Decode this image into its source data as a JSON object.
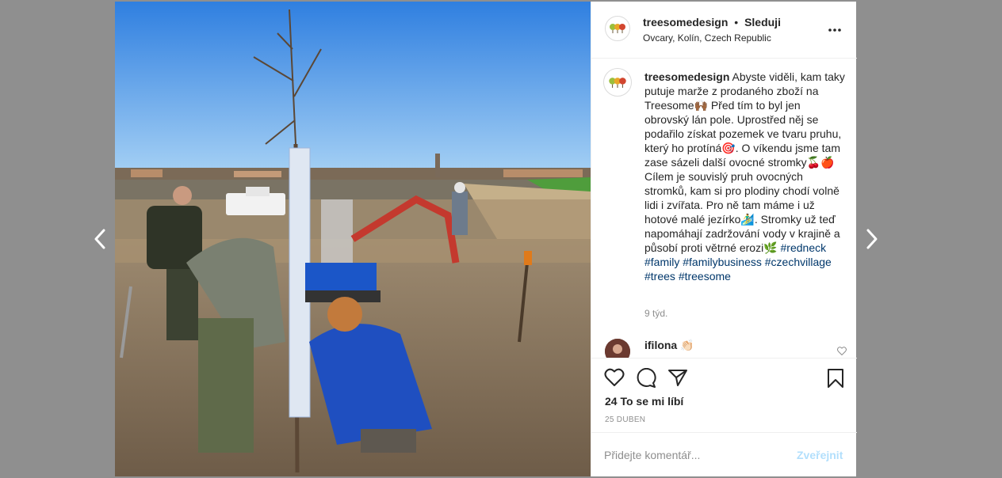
{
  "post": {
    "username": "treesomedesign",
    "separator": "•",
    "follow_label": "Sleduji",
    "location": "Ovcary, Kolín, Czech Republic"
  },
  "caption": {
    "username": "treesomedesign",
    "text": "Abyste viděli, kam taky putuje marže z prodaného zboží na Treesome🙌🏾 Před tím to byl jen obrovský lán pole. Uprostřed něj se podařilo získat pozemek ve tvaru pruhu, který ho protíná🎯. O víkendu jsme tam zase sázeli další ovocné stromky🍒🍎 Cílem je souvislý pruh ovocných stromků, kam si pro plodiny chodí volně lidi i zvířata. Pro ně tam máme i už hotové malé jezírko🏄‍♂️. Stromky už teď napomáhají zadržování vody v krajině a působí proti větrné erozi🌿",
    "hashtags": [
      "#redneck",
      "#family",
      "#familybusiness",
      "#czechvillage",
      "#trees",
      "#treesome"
    ],
    "time_ago": "9 týd."
  },
  "comment": {
    "username": "ifilona",
    "text": "👏🏻"
  },
  "stats": {
    "likes": "24 To se mi líbí",
    "date": "25 DUBEN"
  },
  "comment_box": {
    "placeholder": "Přidejte komentář...",
    "post_label": "Zveřejnit"
  },
  "colors": {
    "link": "#00376b",
    "post_disabled": "#b2dffc",
    "muted": "#8e8e8e",
    "backdrop": "#8f8f8f"
  },
  "icons": [
    "chevron-left-icon",
    "chevron-right-icon",
    "more-icon",
    "heart-icon",
    "comment-icon",
    "share-icon",
    "bookmark-icon"
  ]
}
